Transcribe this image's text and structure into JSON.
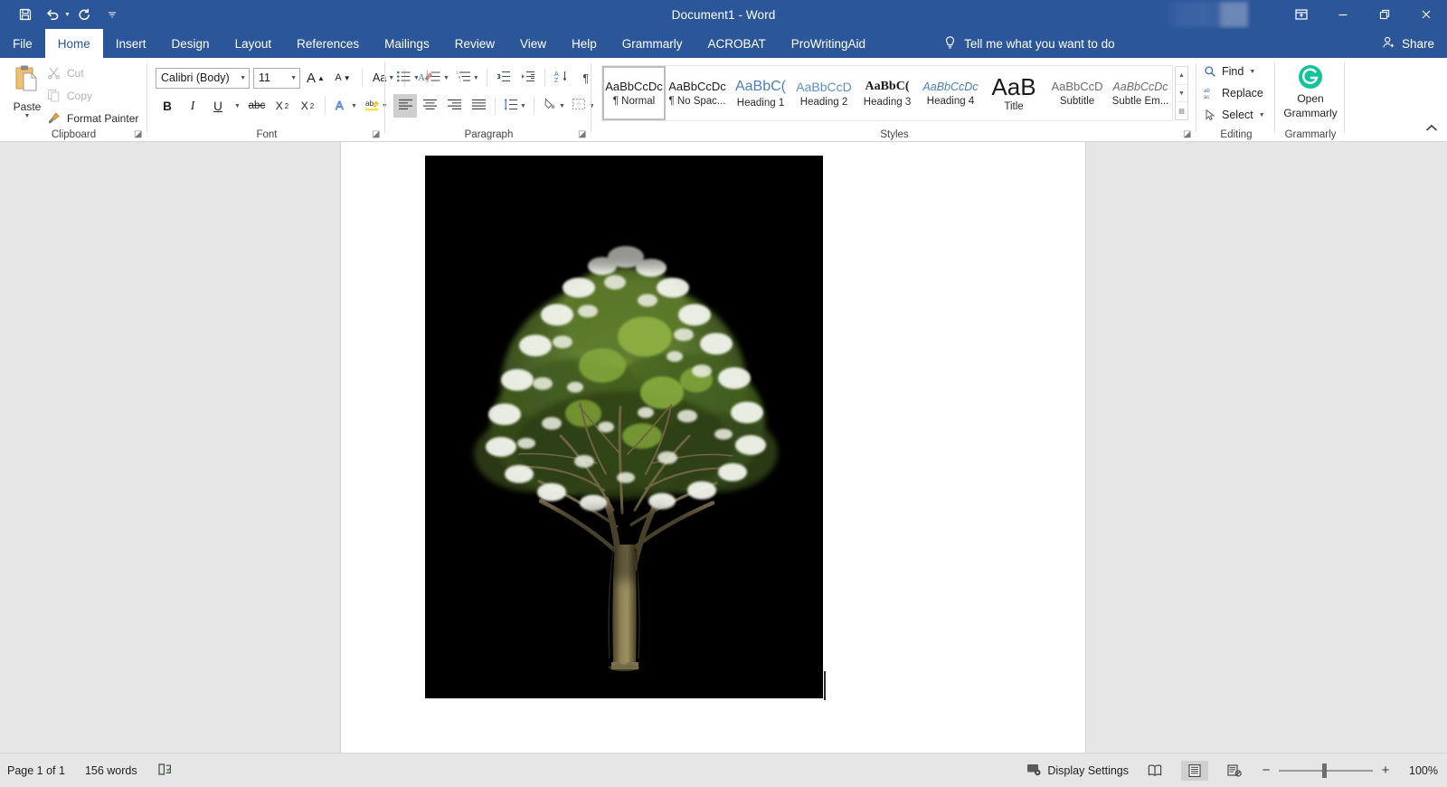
{
  "titlebar": {
    "document_title": "Document1  -  Word",
    "quick_access": [
      {
        "name": "save-icon",
        "label": "Save"
      },
      {
        "name": "undo-icon",
        "label": "Undo"
      },
      {
        "name": "redo-icon",
        "label": "Redo"
      },
      {
        "name": "customize-quick-access-icon",
        "label": "Customize Quick Access Toolbar"
      }
    ],
    "window_controls": [
      {
        "name": "ribbon-display-options-icon",
        "label": "Ribbon Display Options"
      },
      {
        "name": "minimize-icon",
        "label": "Minimize"
      },
      {
        "name": "restore-icon",
        "label": "Restore Down"
      },
      {
        "name": "close-icon",
        "label": "Close"
      }
    ],
    "accent_color": "#2b579a"
  },
  "tabs": [
    {
      "label": "File",
      "active": false
    },
    {
      "label": "Home",
      "active": true
    },
    {
      "label": "Insert",
      "active": false
    },
    {
      "label": "Design",
      "active": false
    },
    {
      "label": "Layout",
      "active": false
    },
    {
      "label": "References",
      "active": false
    },
    {
      "label": "Mailings",
      "active": false
    },
    {
      "label": "Review",
      "active": false
    },
    {
      "label": "View",
      "active": false
    },
    {
      "label": "Help",
      "active": false
    },
    {
      "label": "Grammarly",
      "active": false
    },
    {
      "label": "ACROBAT",
      "active": false
    },
    {
      "label": "ProWritingAid",
      "active": false
    }
  ],
  "tell_me": {
    "label": "Tell me what you want to do",
    "icon": "lightbulb-icon"
  },
  "share": {
    "label": "Share",
    "icon": "share-person-icon"
  },
  "ribbon": {
    "clipboard": {
      "group_label": "Clipboard",
      "paste_label": "Paste",
      "items": [
        {
          "label": "Cut",
          "icon": "scissors-icon",
          "disabled": true
        },
        {
          "label": "Copy",
          "icon": "copy-icon",
          "disabled": true
        },
        {
          "label": "Format Painter",
          "icon": "paintbrush-icon",
          "disabled": false
        }
      ]
    },
    "font": {
      "group_label": "Font",
      "font_family_value": "Calibri (Body)",
      "font_size_value": "11",
      "buttons": [
        {
          "label": "A",
          "name": "grow-font-button"
        },
        {
          "label": "A",
          "name": "shrink-font-button"
        },
        {
          "label": "Aa",
          "name": "change-case-button"
        },
        {
          "label": "",
          "name": "clear-formatting-button"
        },
        {
          "label": "B",
          "name": "bold-button"
        },
        {
          "label": "I",
          "name": "italic-button"
        },
        {
          "label": "U",
          "name": "underline-button"
        },
        {
          "label": "abc",
          "name": "strikethrough-button"
        },
        {
          "label": "X",
          "name": "subscript-button"
        },
        {
          "label": "X",
          "name": "superscript-button"
        },
        {
          "label": "A",
          "name": "text-effects-button"
        },
        {
          "label": "ab",
          "name": "text-highlight-color-button"
        },
        {
          "label": "A",
          "name": "font-color-button"
        }
      ]
    },
    "paragraph": {
      "group_label": "Paragraph",
      "buttons": [
        {
          "name": "bullets-button"
        },
        {
          "name": "numbering-button"
        },
        {
          "name": "multilevel-list-button"
        },
        {
          "name": "decrease-indent-button"
        },
        {
          "name": "increase-indent-button"
        },
        {
          "name": "sort-button"
        },
        {
          "name": "show-formatting-marks-button"
        },
        {
          "name": "align-left-button"
        },
        {
          "name": "align-center-button"
        },
        {
          "name": "align-right-button"
        },
        {
          "name": "justify-button"
        },
        {
          "name": "line-spacing-button"
        },
        {
          "name": "shading-button"
        },
        {
          "name": "borders-button"
        }
      ]
    },
    "styles": {
      "group_label": "Styles",
      "items": [
        {
          "preview": "AaBbCcDc",
          "name": "¶ Normal",
          "active": true,
          "style": "normal"
        },
        {
          "preview": "AaBbCcDc",
          "name": "¶ No Spac...",
          "active": false,
          "style": "nospace"
        },
        {
          "preview": "AaBbC(",
          "name": "Heading 1",
          "active": false,
          "style": "h1"
        },
        {
          "preview": "AaBbCcD",
          "name": "Heading 2",
          "active": false,
          "style": "h2"
        },
        {
          "preview": "AaBbC(",
          "name": "Heading 3",
          "active": false,
          "style": "h3"
        },
        {
          "preview": "AaBbCcDc",
          "name": "Heading 4",
          "active": false,
          "style": "h4"
        },
        {
          "preview": "AaB",
          "name": "Title",
          "active": false,
          "style": "title"
        },
        {
          "preview": "AaBbCcD",
          "name": "Subtitle",
          "active": false,
          "style": "subtitle"
        },
        {
          "preview": "AaBbCcDc",
          "name": "Subtle Em...",
          "active": false,
          "style": "subtleem"
        }
      ]
    },
    "editing": {
      "group_label": "Editing",
      "items": [
        {
          "label": "Find",
          "icon": "magnifier-icon",
          "has_caret": true
        },
        {
          "label": "Replace",
          "icon": "replace-abac-icon",
          "has_caret": false
        },
        {
          "label": "Select",
          "icon": "cursor-arrow-icon",
          "has_caret": true
        }
      ]
    },
    "grammarly": {
      "group_label": "Grammarly",
      "button_line1": "Open",
      "button_line2": "Grammarly",
      "icon": "grammarly-g-icon",
      "brand_color": "#15c39a"
    },
    "collapse_icon": "chevron-up-icon"
  },
  "document": {
    "picture": {
      "name": "tree-image",
      "alt": "Flowering tree with white blossoms on black background",
      "background_color": "#000000"
    }
  },
  "statusbar": {
    "page_indicator": "Page 1 of 1",
    "word_count": "156 words",
    "proofing_icon": "proofing-errors-icon",
    "display_settings_label": "Display Settings",
    "display_settings_icon": "display-settings-icon",
    "views": [
      {
        "name": "read-mode-button",
        "icon": "read-mode-icon",
        "active": false
      },
      {
        "name": "print-layout-button",
        "icon": "print-layout-icon",
        "active": true
      },
      {
        "name": "web-layout-button",
        "icon": "web-layout-icon",
        "active": false
      }
    ],
    "zoom_out_label": "−",
    "zoom_in_label": "+",
    "zoom_level": "100%"
  }
}
